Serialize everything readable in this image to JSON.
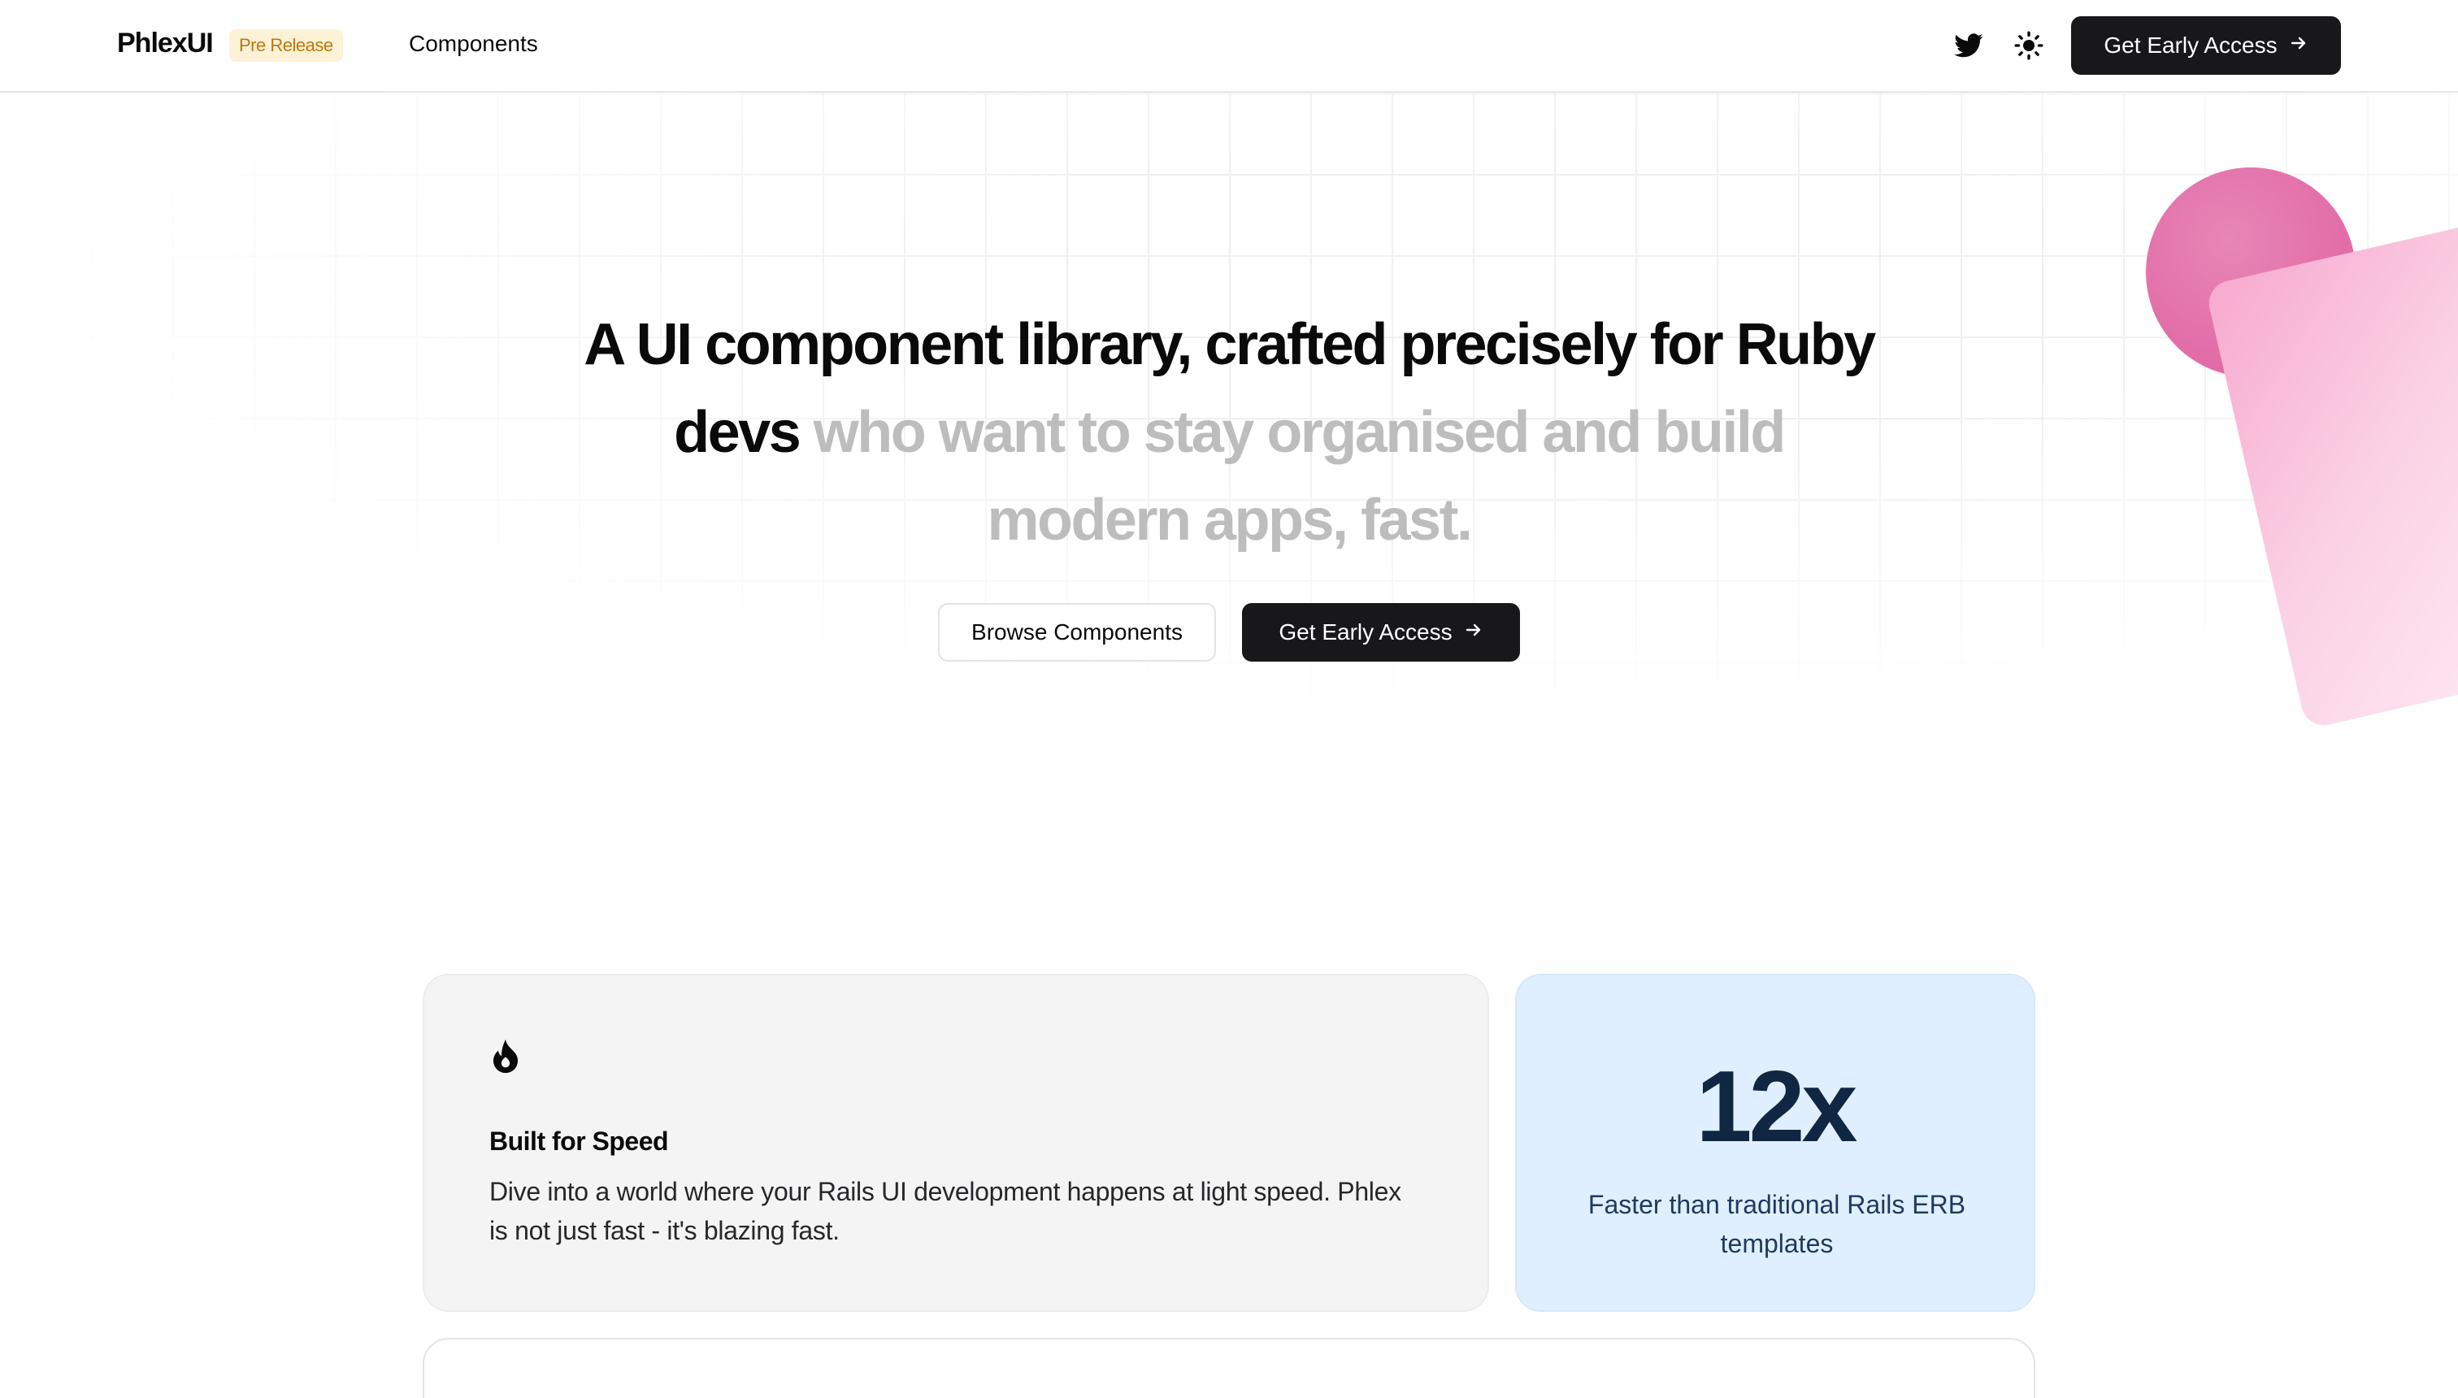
{
  "header": {
    "logo": "PhlexUI",
    "badge": "Pre Release",
    "nav": {
      "components": "Components"
    },
    "cta_label": "Get Early Access",
    "icons": [
      "twitter-icon",
      "sun-icon",
      "arrow-right-icon"
    ]
  },
  "hero": {
    "headline_dark": "A UI component library, crafted precisely for Ruby devs",
    "headline_muted": "who want to stay organised and build modern apps, fast.",
    "secondary_button": "Browse Components",
    "primary_button": "Get Early Access"
  },
  "features": {
    "speed": {
      "icon": "fire-icon",
      "title": "Built for Speed",
      "description": "Dive into a world where your Rails UI development happens at light speed. Phlex is not just fast - it's blazing fast."
    },
    "stat": {
      "value": "12x",
      "label": "Faster than traditional Rails ERB templates"
    }
  },
  "colors": {
    "primary": "#18181b",
    "badge_bg": "#fdf2d6",
    "badge_text": "#c0760d",
    "muted_text": "#bdbdbd",
    "stat_bg": "#e0efff",
    "stat_text": "#0f2742",
    "accent_pink": "#df5f9f"
  }
}
